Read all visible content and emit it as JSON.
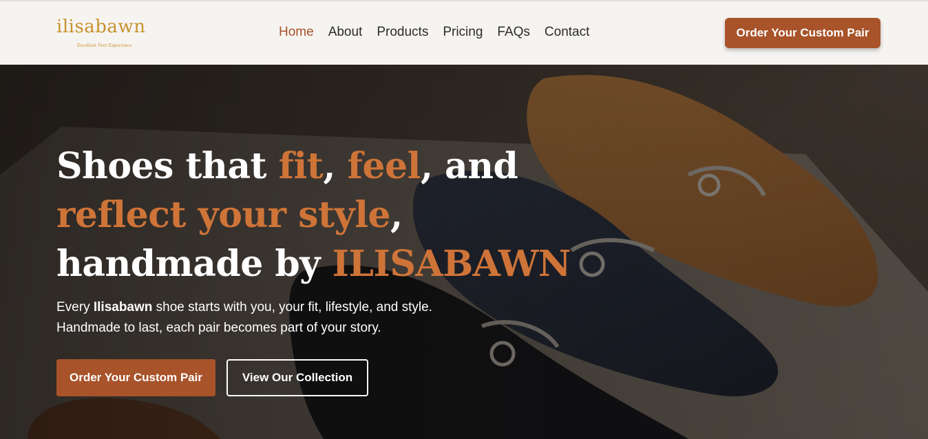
{
  "brand": {
    "name": "ilisabawn",
    "tagline": "Excellent Feet Experience",
    "color": "#c8922d"
  },
  "nav": {
    "items": [
      {
        "label": "Home",
        "active": true
      },
      {
        "label": "About",
        "active": false
      },
      {
        "label": "Products",
        "active": false
      },
      {
        "label": "Pricing",
        "active": false
      },
      {
        "label": "FAQs",
        "active": false
      },
      {
        "label": "Contact",
        "active": false
      }
    ],
    "cta_label": "Order Your Custom Pair"
  },
  "hero": {
    "headline": {
      "l1_a": "Shoes that ",
      "l1_b": "fit",
      "l1_c": ", ",
      "l1_d": "feel",
      "l1_e": ", and",
      "l2_a": "reflect your style",
      "l2_b": ",",
      "l3_a": "handmade by ",
      "l3_b": "ILISABAWN"
    },
    "sub": {
      "p1": "Every ",
      "p2": "Ilisabawn",
      "p3": " shoe starts with you, your fit, lifestyle, and style.",
      "line2": "Handmade to last, each pair becomes part of your story."
    },
    "primary_button": "Order Your Custom Pair",
    "secondary_button": "View Our Collection",
    "background_image": "shoes-photo"
  },
  "colors": {
    "accent": "#a8532a",
    "accent_text": "#cf7438",
    "header_bg": "#f6f4f1",
    "nav_text": "#2b2b2b"
  }
}
